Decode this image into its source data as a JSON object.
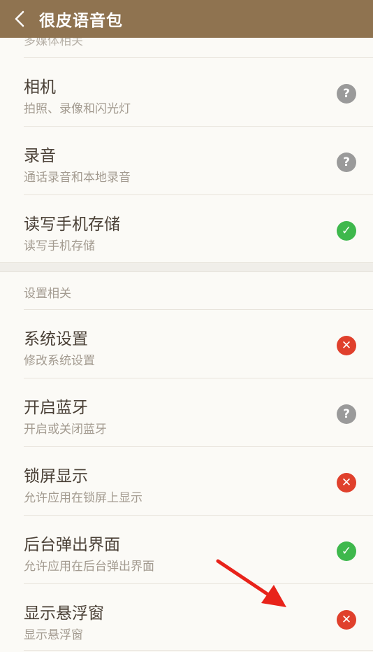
{
  "header": {
    "title": "很皮语音包"
  },
  "section1": {
    "label": "多媒体相关",
    "items": [
      {
        "title": "相机",
        "subtitle": "拍照、录像和闪光灯",
        "status": "unknown"
      },
      {
        "title": "录音",
        "subtitle": "通话录音和本地录音",
        "status": "unknown"
      },
      {
        "title": "读写手机存储",
        "subtitle": "读写手机存储",
        "status": "allowed"
      }
    ]
  },
  "section2": {
    "label": "设置相关",
    "items": [
      {
        "title": "系统设置",
        "subtitle": "修改系统设置",
        "status": "denied"
      },
      {
        "title": "开启蓝牙",
        "subtitle": "开启或关闭蓝牙",
        "status": "unknown"
      },
      {
        "title": "锁屏显示",
        "subtitle": "允许应用在锁屏上显示",
        "status": "denied"
      },
      {
        "title": "后台弹出界面",
        "subtitle": "允许应用在后台弹出界面",
        "status": "allowed"
      },
      {
        "title": "显示悬浮窗",
        "subtitle": "显示悬浮窗",
        "status": "denied"
      }
    ]
  },
  "status_icons": {
    "unknown": "question-icon",
    "allowed": "check-icon",
    "denied": "close-icon"
  },
  "colors": {
    "header": "#8f7350",
    "unknown": "#9a9a9a",
    "allowed": "#3eb84c",
    "denied": "#e0402c",
    "annotation_arrow": "#e8231a"
  }
}
